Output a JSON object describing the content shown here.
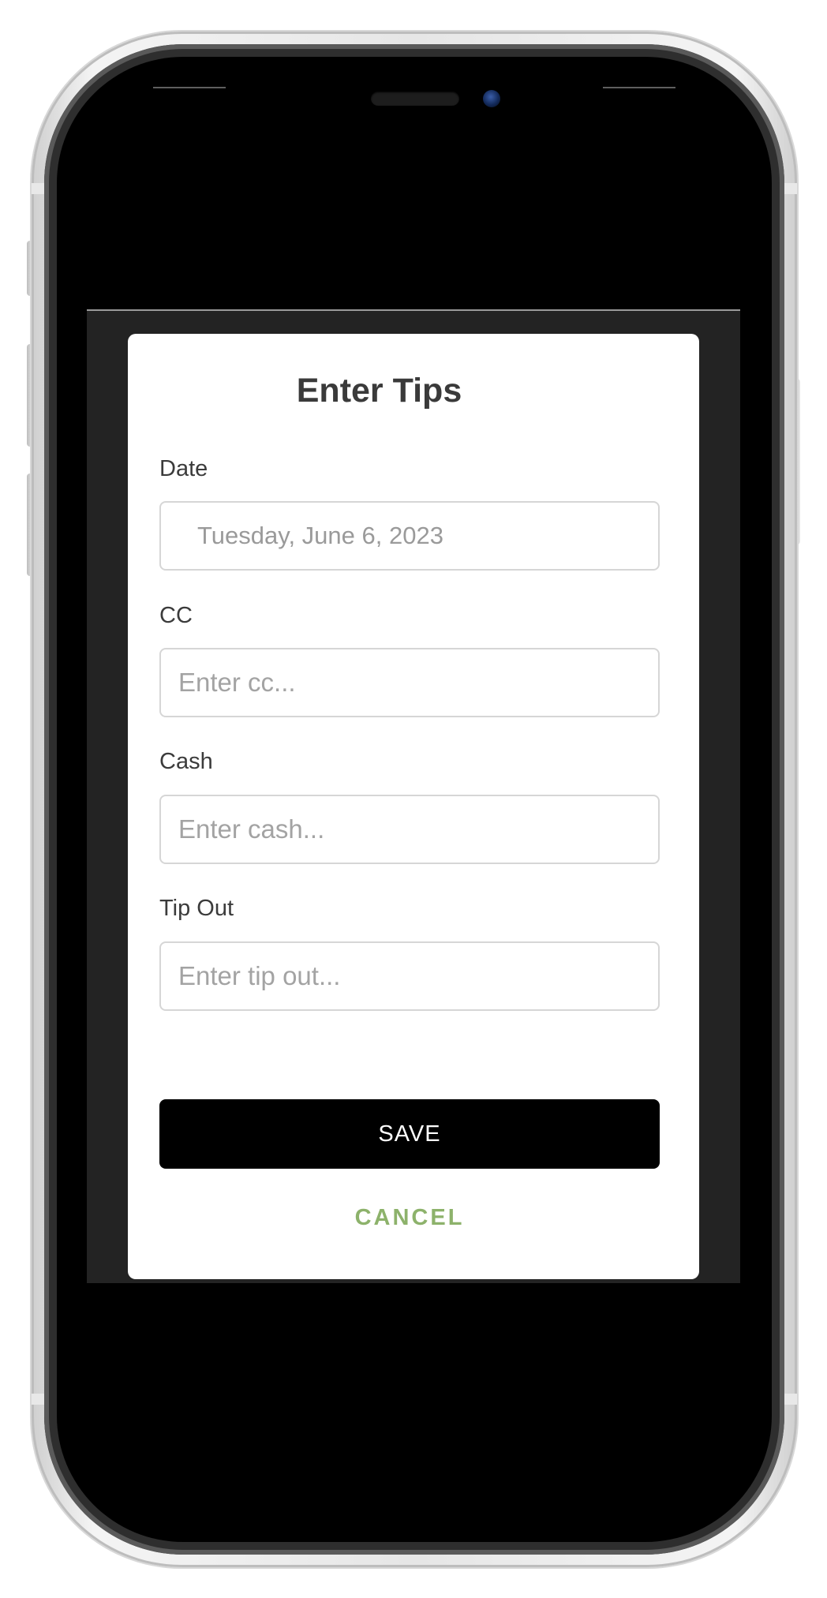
{
  "modal": {
    "title": "Enter Tips",
    "fields": {
      "date": {
        "label": "Date",
        "value": "Tuesday, June 6, 2023"
      },
      "cc": {
        "label": "CC",
        "placeholder": "Enter cc..."
      },
      "cash": {
        "label": "Cash",
        "placeholder": "Enter cash..."
      },
      "tip_out": {
        "label": "Tip Out",
        "placeholder": "Enter tip out..."
      }
    },
    "save_label": "SAVE",
    "cancel_label": "CANCEL"
  },
  "colors": {
    "app_background": "#232323",
    "modal_background": "#ffffff",
    "save_button": "#000000",
    "cancel_text": "#8db26b",
    "title_text": "#3a3a3a",
    "placeholder_text": "#a3a3a3"
  }
}
